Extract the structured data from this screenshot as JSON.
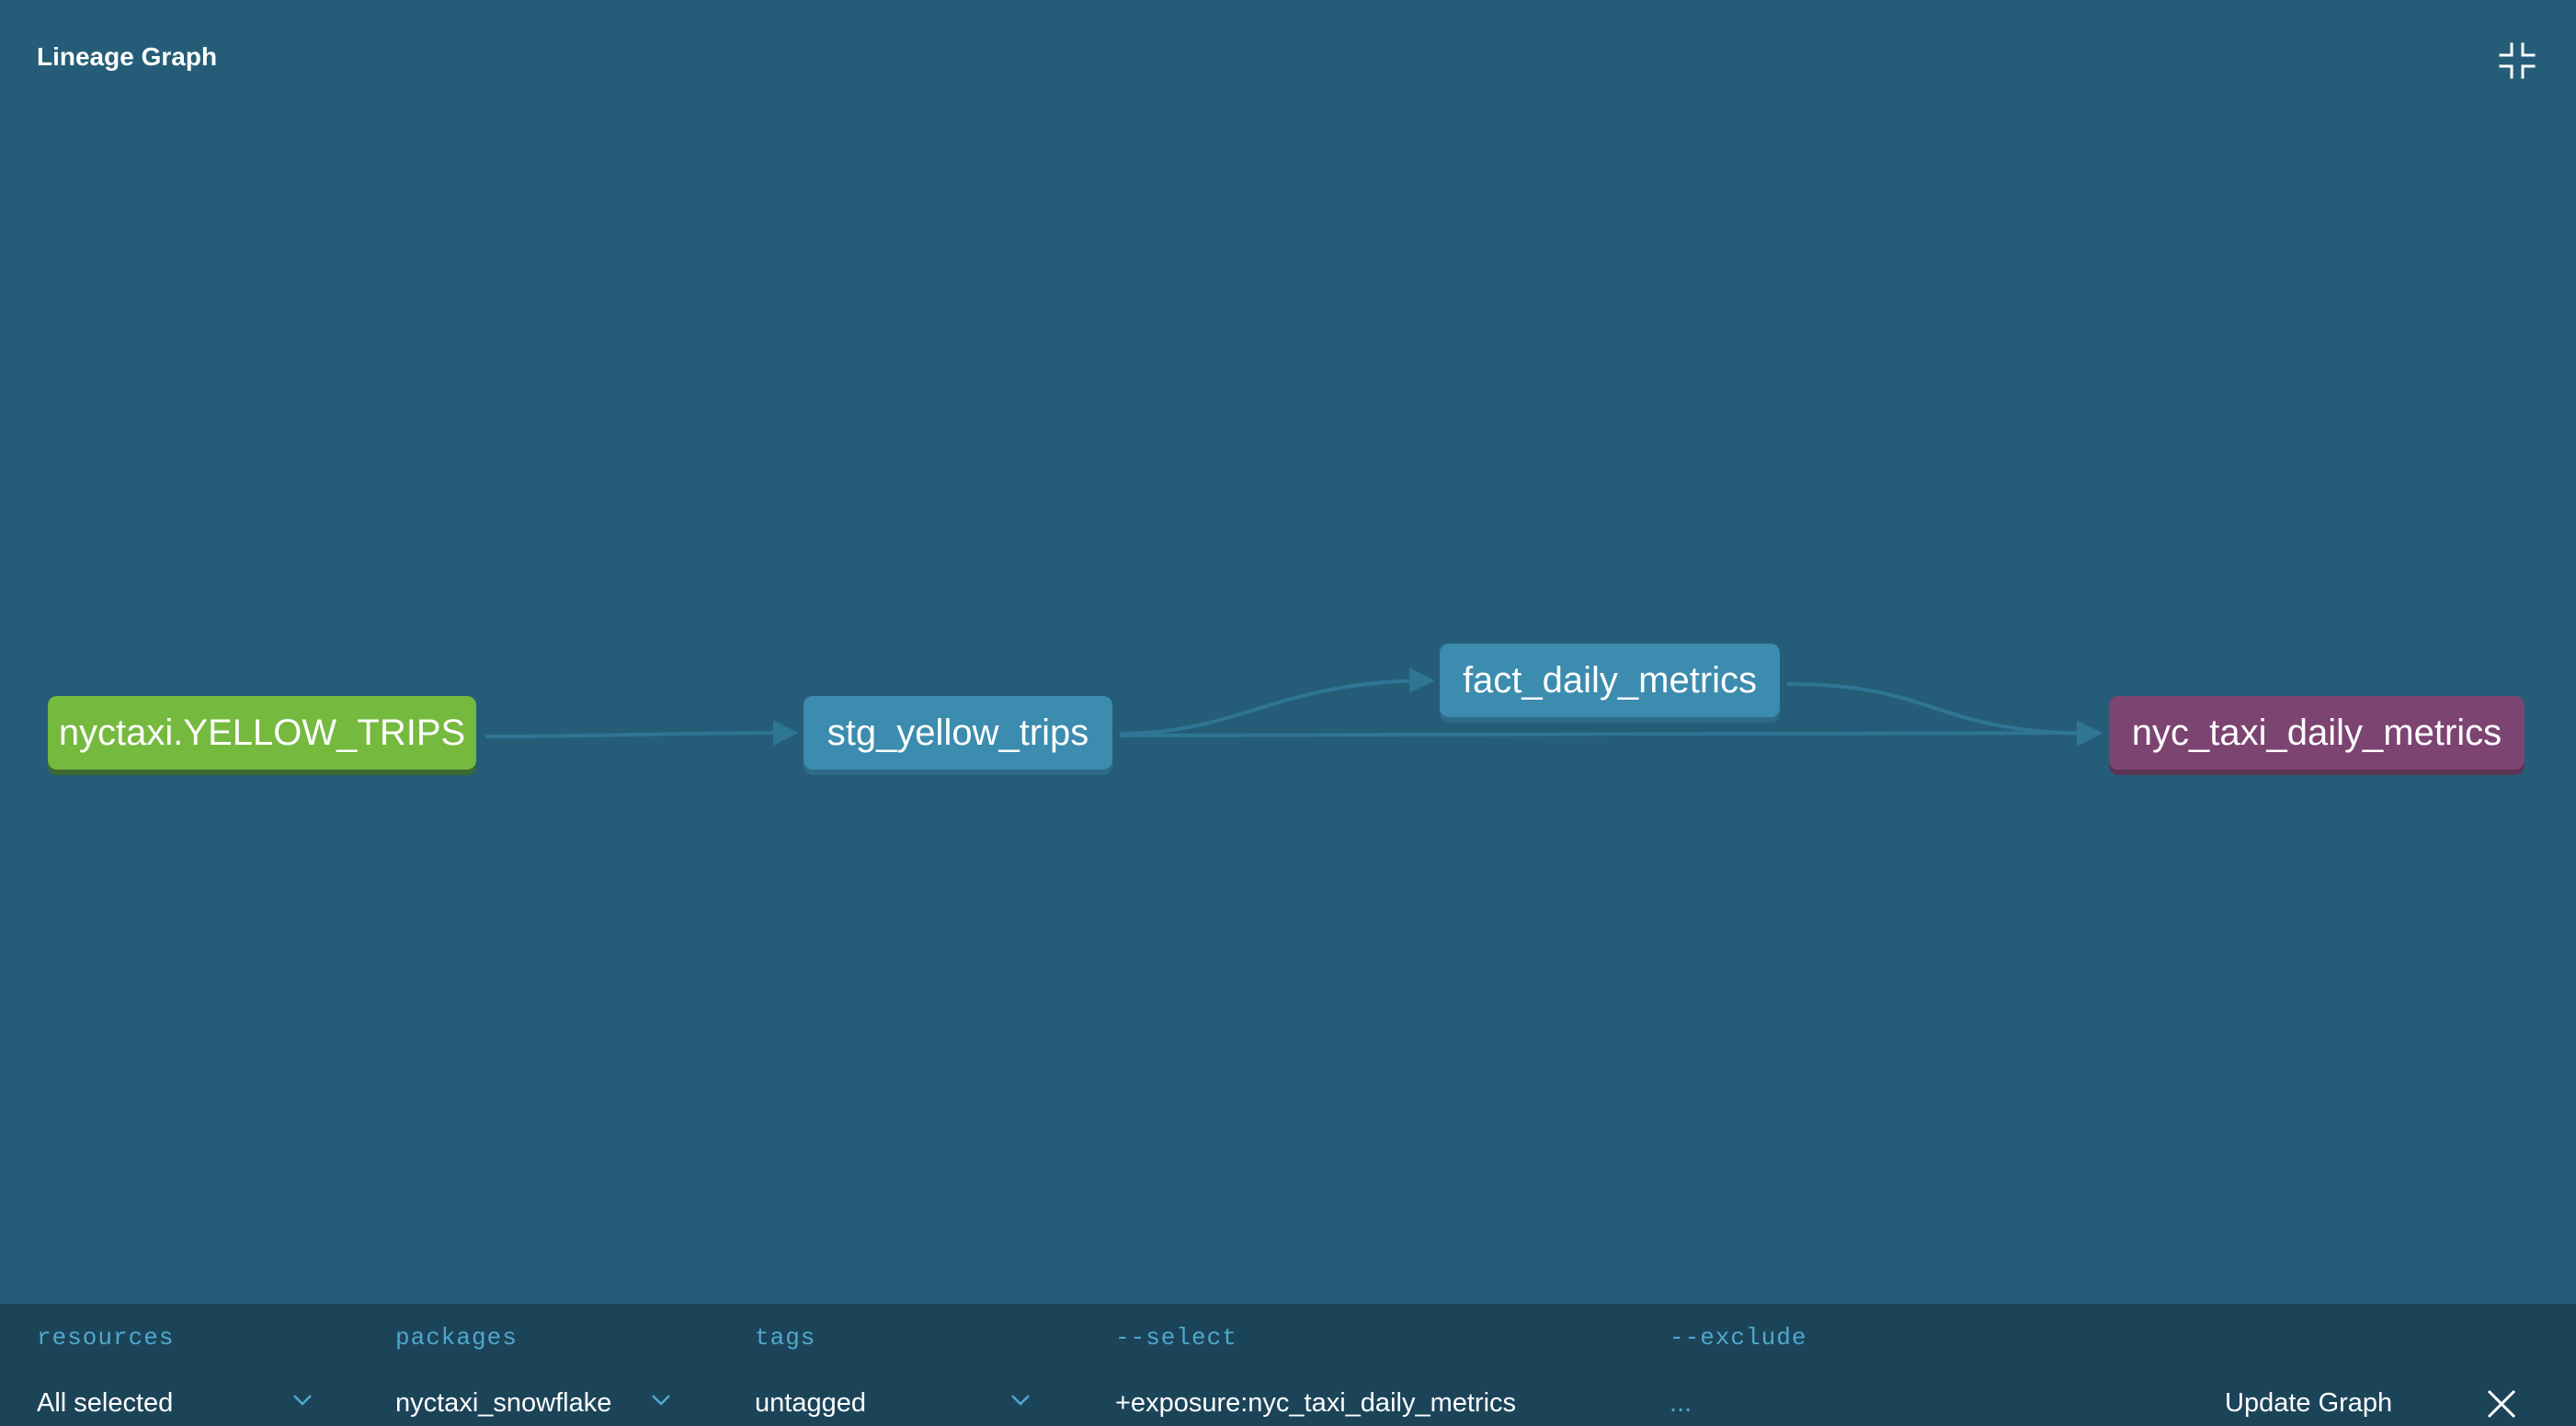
{
  "panel": {
    "title": "Lineage Graph"
  },
  "colors": {
    "canvas": "#255d78",
    "toolbar": "#1c4459",
    "source_node": "#75b93f",
    "model_node": "#3b8cae",
    "exposure_node": "#7c4470",
    "label_accent": "#4fa8cc"
  },
  "icons": {
    "collapse": "collapse-fullscreen-icon",
    "dropdown": "chevron-down-icon",
    "close": "close-icon"
  },
  "graph": {
    "nodes": [
      {
        "id": "source",
        "label": "nyctaxi.YELLOW_TRIPS",
        "kind": "source"
      },
      {
        "id": "staging",
        "label": "stg_yellow_trips",
        "kind": "model"
      },
      {
        "id": "fact",
        "label": "fact_daily_metrics",
        "kind": "model"
      },
      {
        "id": "exposure",
        "label": "nyc_taxi_daily_metrics",
        "kind": "exposure"
      }
    ],
    "edges": [
      {
        "from": "source",
        "to": "staging"
      },
      {
        "from": "staging",
        "to": "fact"
      },
      {
        "from": "staging",
        "to": "exposure"
      },
      {
        "from": "fact",
        "to": "exposure"
      }
    ]
  },
  "toolbar": {
    "resources": {
      "label": "resources",
      "value": "All selected"
    },
    "packages": {
      "label": "packages",
      "value": "nyctaxi_snowflake"
    },
    "tags": {
      "label": "tags",
      "value": "untagged"
    },
    "select": {
      "label": "--select",
      "value": "+exposure:nyc_taxi_daily_metrics"
    },
    "exclude": {
      "label": "--exclude",
      "value": "..."
    },
    "update_label": "Update Graph"
  }
}
